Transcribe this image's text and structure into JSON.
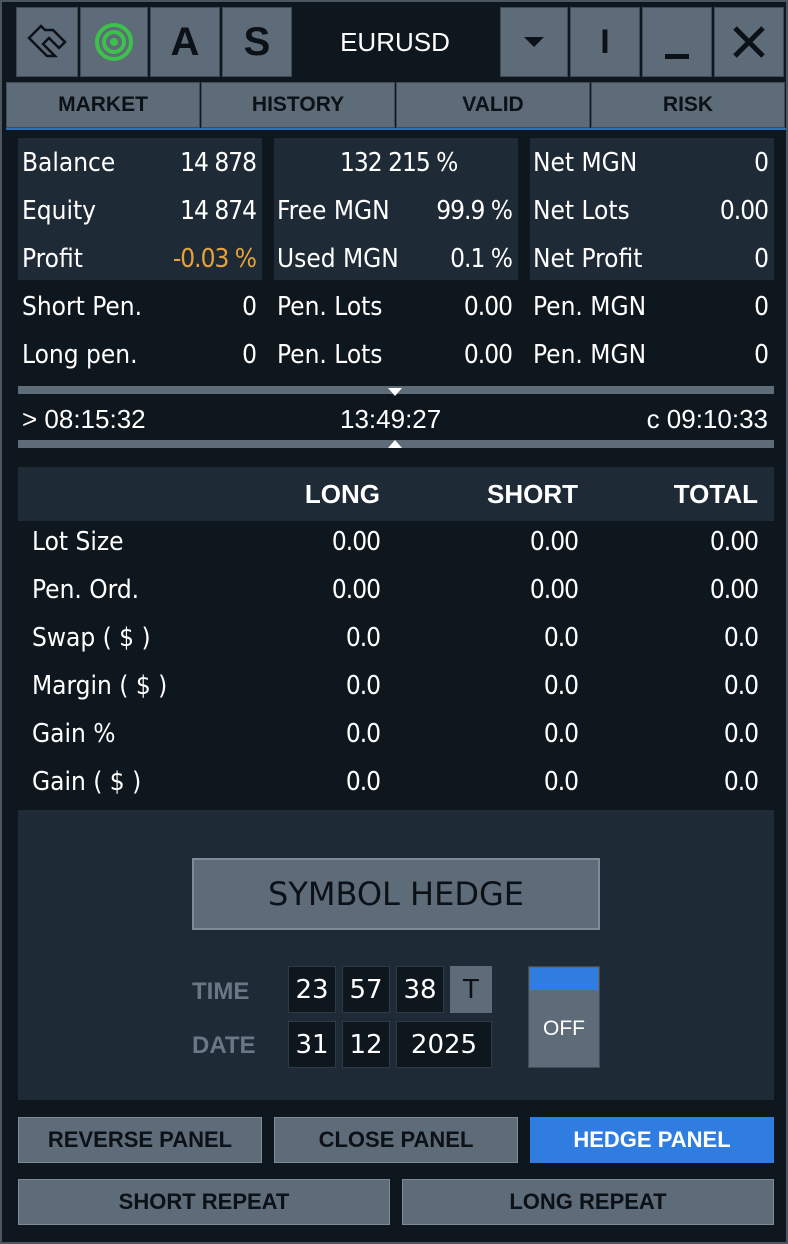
{
  "toolbar": {
    "a_label": "A",
    "s_label": "S",
    "symbol": "EURUSD",
    "i_label": "I"
  },
  "tabs": [
    "MARKET",
    "HISTORY",
    "VALID",
    "RISK"
  ],
  "account": {
    "balance_label": "Balance",
    "balance": "14 878",
    "equity_label": "Equity",
    "equity": "14 874",
    "profit_label": "Profit",
    "profit": "-0.03 %",
    "margin_level": "132 215 %",
    "free_mgn_label": "Free MGN",
    "free_mgn": "99.9 %",
    "used_mgn_label": "Used MGN",
    "used_mgn": "0.1 %",
    "net_mgn_label": "Net MGN",
    "net_mgn": "0",
    "net_lots_label": "Net Lots",
    "net_lots": "0.00",
    "net_profit_label": "Net Profit",
    "net_profit": "0"
  },
  "pending": {
    "short_label": "Short Pen.",
    "short": "0",
    "long_label": "Long pen.",
    "long": "0",
    "lots_label": "Pen. Lots",
    "short_lots": "0.00",
    "long_lots": "0.00",
    "mgn_label": "Pen. MGN",
    "short_mgn": "0",
    "long_mgn": "0"
  },
  "clock": {
    "open": "> 08:15:32",
    "now": "13:49:27",
    "close": "c 09:10:33"
  },
  "table": {
    "headers": [
      "LONG",
      "SHORT",
      "TOTAL"
    ],
    "rows": [
      {
        "label": "Lot Size",
        "long": "0.00",
        "short": "0.00",
        "total": "0.00"
      },
      {
        "label": "Pen. Ord.",
        "long": "0.00",
        "short": "0.00",
        "total": "0.00"
      },
      {
        "label": "Swap ( $ )",
        "long": "0.0",
        "short": "0.0",
        "total": "0.0"
      },
      {
        "label": "Margin ( $ )",
        "long": "0.0",
        "short": "0.0",
        "total": "0.0"
      },
      {
        "label": "Gain %",
        "long": "0.0",
        "short": "0.0",
        "total": "0.0"
      },
      {
        "label": "Gain ( $ )",
        "long": "0.0",
        "short": "0.0",
        "total": "0.0"
      }
    ]
  },
  "hedge": {
    "button": "SYMBOL HEDGE",
    "time_label": "TIME",
    "hour": "23",
    "minute": "57",
    "second": "38",
    "t_label": "T",
    "date_label": "DATE",
    "day": "31",
    "month": "12",
    "year": "2025",
    "toggle": "OFF"
  },
  "buttons": {
    "reverse": "REVERSE PANEL",
    "close": "CLOSE PANEL",
    "hedge": "HEDGE PANEL",
    "short_repeat": "SHORT REPEAT",
    "long_repeat": "LONG REPEAT"
  },
  "colors": {
    "accent": "#2f7de0",
    "negative": "#e8a23a",
    "target": "#3cc24a"
  }
}
